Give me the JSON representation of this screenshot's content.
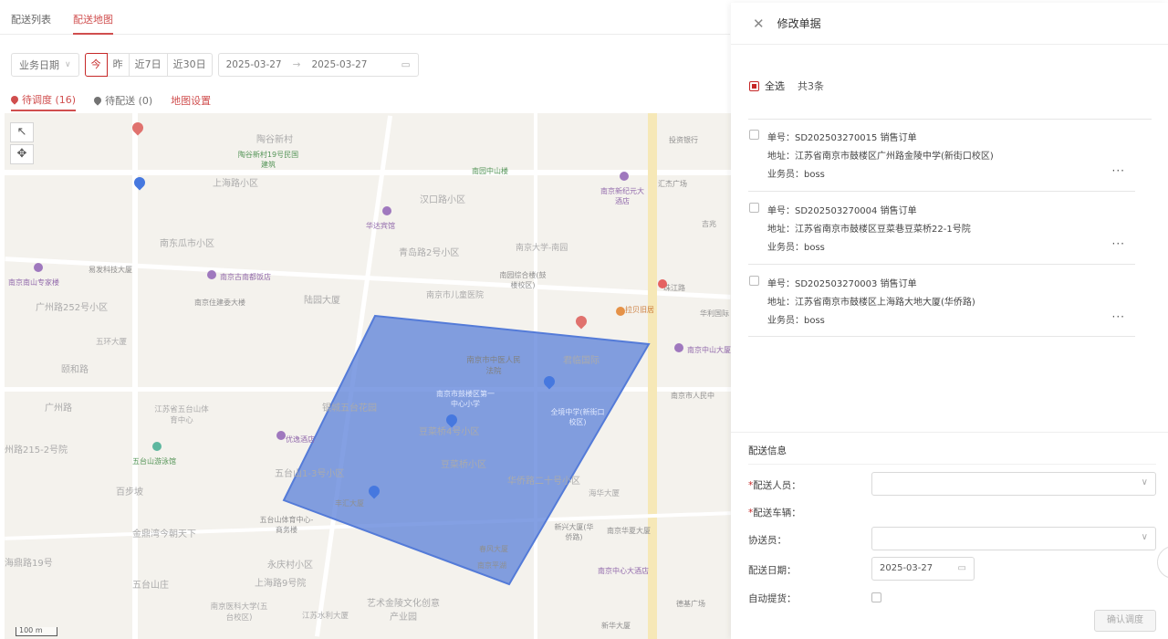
{
  "tabs": [
    "配送列表",
    "配送地图"
  ],
  "filter": {
    "date_type": "业务日期",
    "quick": [
      "今",
      "昨",
      "近7日",
      "近30日"
    ],
    "start": "2025-03-27",
    "sep": "→",
    "end": "2025-03-27"
  },
  "status": {
    "pending_dispatch": "待调度 (16)",
    "pending_delivery": "待配送 (0)",
    "map_settings": "地图设置"
  },
  "map": {
    "scale": "100 m",
    "labels": [
      "陶谷新村",
      "上海路小区",
      "南东瓜市小区",
      "汉口路小区",
      "青岛路2号小区",
      "南京大学-南园",
      "广州路252号小区",
      "陆园大厦",
      "南京市儿童医院",
      "五环大厦",
      "颐和路",
      "江苏省五台山体育中心",
      "银城五台花园",
      "豆菜桥4号小区",
      "豆菜桥小区",
      "五台山1-3号小区",
      "百步坡",
      "金鼎湾今朝天下",
      "永庆村小区",
      "上海路9号院",
      "五台山庄",
      "南京医科大学(五台校区)",
      "江苏水利大厦",
      "艺术金陵文化创意产业园",
      "华侨路二十号小区",
      "海华大厦",
      "君临国际",
      "南京市中医人民法院",
      "投资银行",
      "汇杰广场",
      "南京南山专家楼",
      "易发科技大厦",
      "南京古南都饭店",
      "南京住建委大楼",
      "南园综合楼(鼓楼校区)",
      "华达宾馆",
      "南园中山楼",
      "陶谷新村19号民国建筑",
      "南京新纪元大酒店",
      "拉贝旧居",
      "珠江路",
      "优逸酒店",
      "五台山游泳馆",
      "丰汇大厦",
      "五台山体育中心-商务楼",
      "春风大厦",
      "南京平湖",
      "新兴大厦(华侨路)",
      "南京华夏大厦",
      "南京中心大酒店",
      "新华大厦",
      "德基广场",
      "南京中山大厦",
      "南京市人民中",
      "吉兆",
      "华利国际",
      "州路215-2号院",
      "广州路",
      "海鼎路19号",
      "南京市鼓楼区第一中心小学",
      "全境中学(新街口校区)"
    ]
  },
  "drawer": {
    "close": "✕",
    "title": "修改单据",
    "select_all": "全选",
    "count": "共3条",
    "orders": [
      {
        "no": "单号：SD202503270015  销售订单",
        "addr": "地址：江苏省南京市鼓楼区广州路金陵中学(新街口校区)",
        "rep": "业务员：boss"
      },
      {
        "no": "单号：SD202503270004  销售订单",
        "addr": "地址：江苏省南京市鼓楼区豆菜巷豆菜桥22-1号院",
        "rep": "业务员：boss"
      },
      {
        "no": "单号：SD202503270003  销售订单",
        "addr": "地址：江苏省南京市鼓楼区上海路大地大厦(华侨路)",
        "rep": "业务员：boss"
      }
    ],
    "more": "···",
    "info_title": "配送信息",
    "fields": {
      "courier": "配送人员：",
      "vehicle": "配送车辆：",
      "assistant": "协送员：",
      "date": "配送日期：",
      "date_value": "2025-03-27",
      "auto": "自动提货："
    },
    "confirm": "确认调度"
  },
  "colors": {
    "accent": "#c62828",
    "polygon": "#2f5fd0",
    "pin": "#1e5bd8"
  },
  "icons": [
    "close-icon",
    "calendar-icon",
    "chevron-down-icon",
    "map-pin-icon",
    "more-icon",
    "cursor-icon",
    "move-icon"
  ]
}
